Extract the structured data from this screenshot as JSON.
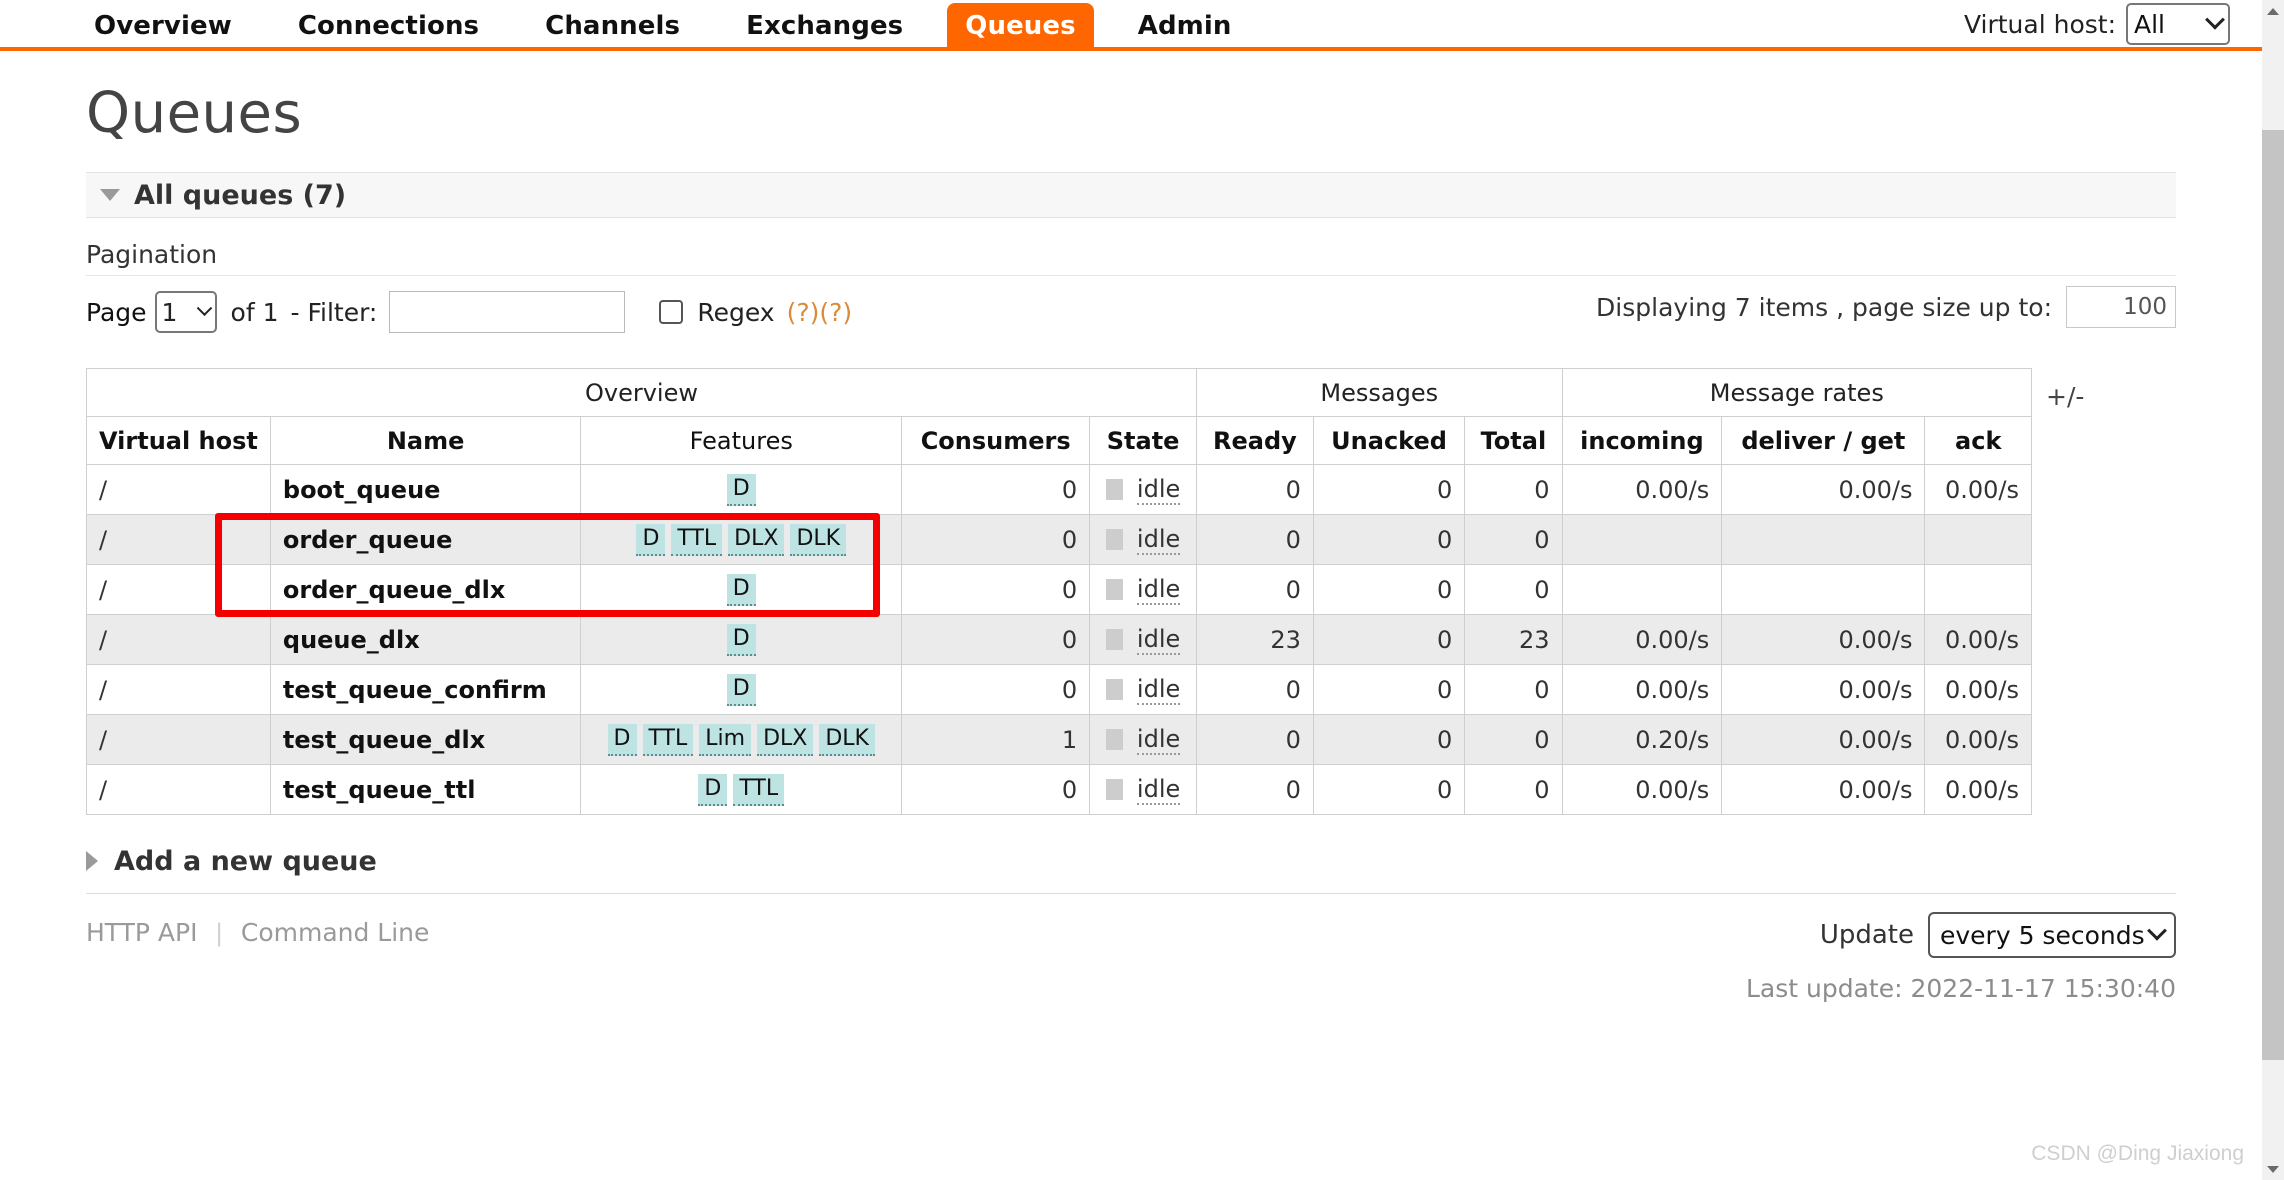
{
  "nav": {
    "tabs": [
      {
        "label": "Overview",
        "active": false
      },
      {
        "label": "Connections",
        "active": false
      },
      {
        "label": "Channels",
        "active": false
      },
      {
        "label": "Exchanges",
        "active": false
      },
      {
        "label": "Queues",
        "active": true
      },
      {
        "label": "Admin",
        "active": false
      }
    ],
    "vhost_label": "Virtual host:",
    "vhost_value": "All",
    "accent_color": "#FF6600"
  },
  "page": {
    "title": "Queues",
    "section_all_queues": "All queues (7)",
    "pagination_label": "Pagination",
    "add_new_queue": "Add a new queue"
  },
  "pagination": {
    "page_label": "Page",
    "page_value": "1",
    "of_label": "of 1",
    "filter_label": "- Filter:",
    "filter_value": "",
    "filter_placeholder": "",
    "regex_label": "Regex",
    "help_1": "(?)",
    "help_2": "(?)",
    "displaying": "Displaying 7 items , page size up to:",
    "page_size": "100"
  },
  "table": {
    "group_headers": [
      {
        "label": "Overview",
        "span": 5
      },
      {
        "label": "Messages",
        "span": 3
      },
      {
        "label": "Message rates",
        "span": 3
      }
    ],
    "columns": [
      {
        "label": "Virtual host",
        "bold": true
      },
      {
        "label": "Name",
        "bold": true
      },
      {
        "label": "Features",
        "bold": false
      },
      {
        "label": "Consumers",
        "bold": true
      },
      {
        "label": "State",
        "bold": true
      },
      {
        "label": "Ready",
        "bold": true
      },
      {
        "label": "Unacked",
        "bold": true
      },
      {
        "label": "Total",
        "bold": true
      },
      {
        "label": "incoming",
        "bold": true
      },
      {
        "label": "deliver / get",
        "bold": true
      },
      {
        "label": "ack",
        "bold": true
      }
    ],
    "toggle_columns": "+/-",
    "rows": [
      {
        "vhost": "/",
        "name": "boot_queue",
        "features": [
          "D"
        ],
        "consumers": "0",
        "state": "idle",
        "ready": "0",
        "unacked": "0",
        "total": "0",
        "incoming": "0.00/s",
        "deliver_get": "0.00/s",
        "ack": "0.00/s"
      },
      {
        "vhost": "/",
        "name": "order_queue",
        "features": [
          "D",
          "TTL",
          "DLX",
          "DLK"
        ],
        "consumers": "0",
        "state": "idle",
        "ready": "0",
        "unacked": "0",
        "total": "0",
        "incoming": "",
        "deliver_get": "",
        "ack": ""
      },
      {
        "vhost": "/",
        "name": "order_queue_dlx",
        "features": [
          "D"
        ],
        "consumers": "0",
        "state": "idle",
        "ready": "0",
        "unacked": "0",
        "total": "0",
        "incoming": "",
        "deliver_get": "",
        "ack": ""
      },
      {
        "vhost": "/",
        "name": "queue_dlx",
        "features": [
          "D"
        ],
        "consumers": "0",
        "state": "idle",
        "ready": "23",
        "unacked": "0",
        "total": "23",
        "incoming": "0.00/s",
        "deliver_get": "0.00/s",
        "ack": "0.00/s"
      },
      {
        "vhost": "/",
        "name": "test_queue_confirm",
        "features": [
          "D"
        ],
        "consumers": "0",
        "state": "idle",
        "ready": "0",
        "unacked": "0",
        "total": "0",
        "incoming": "0.00/s",
        "deliver_get": "0.00/s",
        "ack": "0.00/s"
      },
      {
        "vhost": "/",
        "name": "test_queue_dlx",
        "features": [
          "D",
          "TTL",
          "Lim",
          "DLX",
          "DLK"
        ],
        "consumers": "1",
        "state": "idle",
        "ready": "0",
        "unacked": "0",
        "total": "0",
        "incoming": "0.20/s",
        "deliver_get": "0.00/s",
        "ack": "0.00/s"
      },
      {
        "vhost": "/",
        "name": "test_queue_ttl",
        "features": [
          "D",
          "TTL"
        ],
        "consumers": "0",
        "state": "idle",
        "ready": "0",
        "unacked": "0",
        "total": "0",
        "incoming": "0.00/s",
        "deliver_get": "0.00/s",
        "ack": "0.00/s"
      }
    ]
  },
  "footer": {
    "http_api": "HTTP API",
    "command_line": "Command Line",
    "update_label": "Update",
    "update_value": "every 5 seconds",
    "last_update": "Last update: 2022-11-17 15:30:40"
  },
  "watermark": "CSDN @Ding Jiaxiong",
  "annotation": {
    "color": "#F40000"
  }
}
